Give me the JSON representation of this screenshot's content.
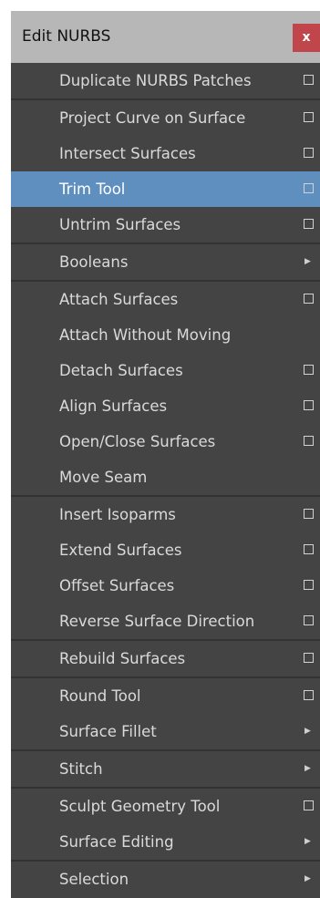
{
  "window": {
    "title": "Edit NURBS",
    "close_label": "x",
    "accent_color": "#5f8fbf",
    "close_color": "#c1464b"
  },
  "menu": {
    "items": [
      {
        "label": "Duplicate NURBS Patches",
        "option_box": true,
        "submenu": false
      },
      {
        "separator": true
      },
      {
        "label": "Project Curve on Surface",
        "option_box": true,
        "submenu": false
      },
      {
        "label": "Intersect Surfaces",
        "option_box": true,
        "submenu": false
      },
      {
        "label": "Trim Tool",
        "option_box": true,
        "submenu": false,
        "highlighted": true
      },
      {
        "label": "Untrim Surfaces",
        "option_box": true,
        "submenu": false
      },
      {
        "separator": true
      },
      {
        "label": "Booleans",
        "option_box": false,
        "submenu": true
      },
      {
        "separator": true
      },
      {
        "label": "Attach Surfaces",
        "option_box": true,
        "submenu": false
      },
      {
        "label": "Attach Without Moving",
        "option_box": false,
        "submenu": false
      },
      {
        "label": "Detach Surfaces",
        "option_box": true,
        "submenu": false
      },
      {
        "label": "Align Surfaces",
        "option_box": true,
        "submenu": false
      },
      {
        "label": "Open/Close Surfaces",
        "option_box": true,
        "submenu": false
      },
      {
        "label": "Move Seam",
        "option_box": false,
        "submenu": false
      },
      {
        "separator": true
      },
      {
        "label": "Insert Isoparms",
        "option_box": true,
        "submenu": false
      },
      {
        "label": "Extend Surfaces",
        "option_box": true,
        "submenu": false
      },
      {
        "label": "Offset Surfaces",
        "option_box": true,
        "submenu": false
      },
      {
        "label": "Reverse Surface Direction",
        "option_box": true,
        "submenu": false
      },
      {
        "separator": true
      },
      {
        "label": "Rebuild Surfaces",
        "option_box": true,
        "submenu": false
      },
      {
        "separator": true
      },
      {
        "label": "Round Tool",
        "option_box": true,
        "submenu": false
      },
      {
        "label": "Surface Fillet",
        "option_box": false,
        "submenu": true
      },
      {
        "separator": true
      },
      {
        "label": "Stitch",
        "option_box": false,
        "submenu": true
      },
      {
        "separator": true
      },
      {
        "label": "Sculpt Geometry Tool",
        "option_box": true,
        "submenu": false
      },
      {
        "label": "Surface Editing",
        "option_box": false,
        "submenu": true
      },
      {
        "separator": true
      },
      {
        "label": "Selection",
        "option_box": false,
        "submenu": true
      }
    ]
  }
}
